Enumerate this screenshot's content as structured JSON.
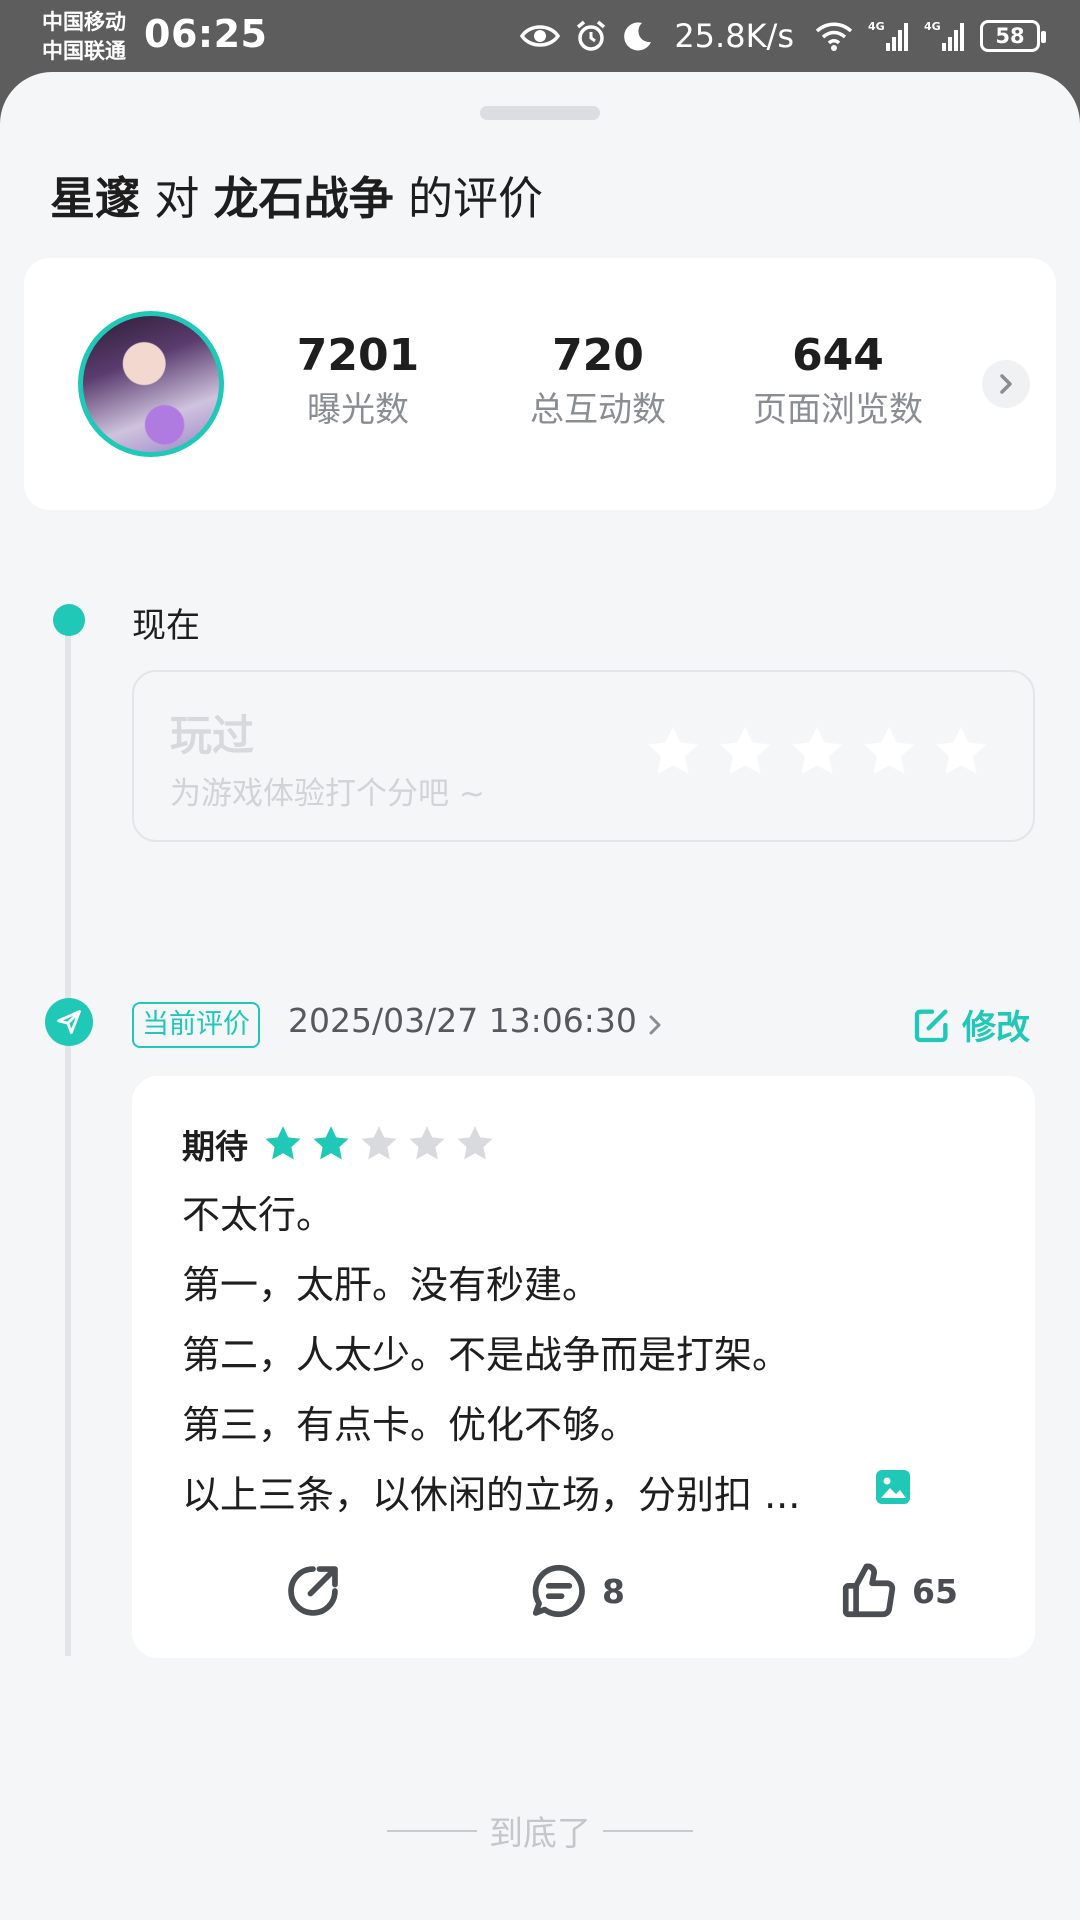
{
  "status_bar": {
    "carrier_1": "中国移动",
    "carrier_2": "中国联通",
    "time": "06:25",
    "net_speed": "25.8K/s",
    "battery": "58",
    "icons": [
      "eye-icon",
      "alarm-icon",
      "moon-icon",
      "wifi-icon",
      "signal-4g-icon",
      "signal-4g-icon",
      "battery-icon"
    ]
  },
  "header": {
    "user_name": "星邃",
    "connector": "对",
    "game_name": "龙石战争",
    "suffix": "的评价"
  },
  "stats": [
    {
      "value": "7201",
      "label": "曝光数"
    },
    {
      "value": "720",
      "label": "总互动数"
    },
    {
      "value": "644",
      "label": "页面浏览数"
    }
  ],
  "timeline": {
    "now_label": "现在",
    "rate_box": {
      "title": "玩过",
      "hint": "为游戏体验打个分吧 ~",
      "stars": 5
    },
    "current": {
      "badge": "当前评价",
      "date": "2025/03/27 13:06:30",
      "edit_label": "修改"
    }
  },
  "review": {
    "rating_label": "期待",
    "rating": 2,
    "rating_max": 5,
    "lines": [
      "不太行。",
      "第一，太肝。没有秒建。",
      "第二，人太少。不是战争而是打架。",
      "第三，有点卡。优化不够。",
      "以上三条，以休闲的立场，分别扣 ..."
    ],
    "comment_count": "8",
    "like_count": "65"
  },
  "footer": {
    "end_text": "到底了"
  },
  "colors": {
    "accent": "#20c8b7",
    "star_empty": "#d9dadd",
    "background": "#f5f6f8"
  }
}
